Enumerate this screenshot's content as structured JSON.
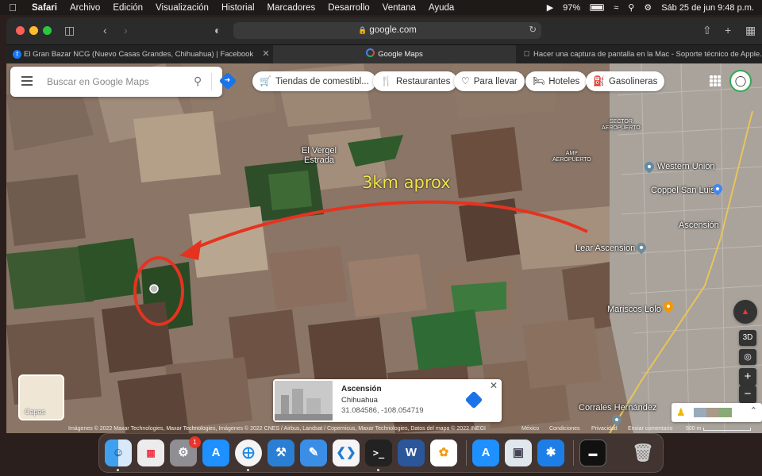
{
  "menubar": {
    "items": [
      "Safari",
      "Archivo",
      "Edición",
      "Visualización",
      "Historial",
      "Marcadores",
      "Desarrollo",
      "Ventana",
      "Ayuda"
    ],
    "battery": "97%",
    "datetime": "Sáb 25 de jun  9:48 p.m."
  },
  "browser": {
    "url": "google.com",
    "tabs": [
      {
        "label": "El Gran Bazar NCG (Nuevo Casas Grandes, Chihuahua) | Facebook",
        "icon": "facebook-icon"
      },
      {
        "label": "Google Maps",
        "icon": "google-icon"
      },
      {
        "label": "Hacer una captura de pantalla en la Mac - Soporte técnico de Apple...",
        "icon": "apple-icon"
      }
    ]
  },
  "maps": {
    "search_placeholder": "Buscar en Google Maps",
    "chips": [
      {
        "label": "Tiendas de comestibl...",
        "icon": "cart-icon"
      },
      {
        "label": "Restaurantes",
        "icon": "fork-knife-icon"
      },
      {
        "label": "Para llevar",
        "icon": "takeout-icon"
      },
      {
        "label": "Hoteles",
        "icon": "bed-icon"
      },
      {
        "label": "Gasolineras",
        "icon": "fuel-icon"
      }
    ],
    "place_labels": {
      "el_vergel": "El Vergel\nEstrada",
      "sector_aeropuerto": "SECTOR\nAEROPUERTO",
      "amp_aeropuerto": "AMP\nAEROPUERTO",
      "western_union": "Western Union",
      "coppel": "Coppel San Luis",
      "ascension": "Ascensión",
      "lear": "Lear Ascension",
      "mariscos": "Mariscos Lolo",
      "corrales": "Corrales Hernández"
    },
    "annotation": "3km aprox",
    "layers_label": "Capas",
    "info_card": {
      "title": "Ascensión",
      "subtitle": "Chihuahua",
      "coords": "31.084586, -108.054719"
    },
    "controls": {
      "view3d": "3D",
      "zoom_in": "+",
      "zoom_out": "−"
    },
    "attribution": {
      "imagery": "Imágenes © 2022 Maxar Technologies, Maxar Technologies, Imágenes © 2022 CNES / Airbus, Landsat / Copernicus, Maxar Technologies, Datos del mapa © 2022 INEGI",
      "country": "México",
      "terms": "Condiciones",
      "privacy": "Privacidad",
      "feedback": "Enviar comentario",
      "scale": "500 m"
    },
    "colors": {
      "annotation_arrow": "#e5331f",
      "annotation_text": "#f2e44a",
      "accent": "#1a73e8"
    }
  },
  "dock": {
    "apps": [
      "Finder",
      "Launchpad",
      "Configuración del Sistema",
      "App Store",
      "Safari",
      "Xcode",
      "Simulator",
      "Visual Studio Code",
      "Terminal",
      "Microsoft Word",
      "Fotos",
      "Instruments",
      "Vista Previa",
      "Bluetooth",
      "Pantalla",
      "Papelera"
    ],
    "settings_badge": "1"
  }
}
